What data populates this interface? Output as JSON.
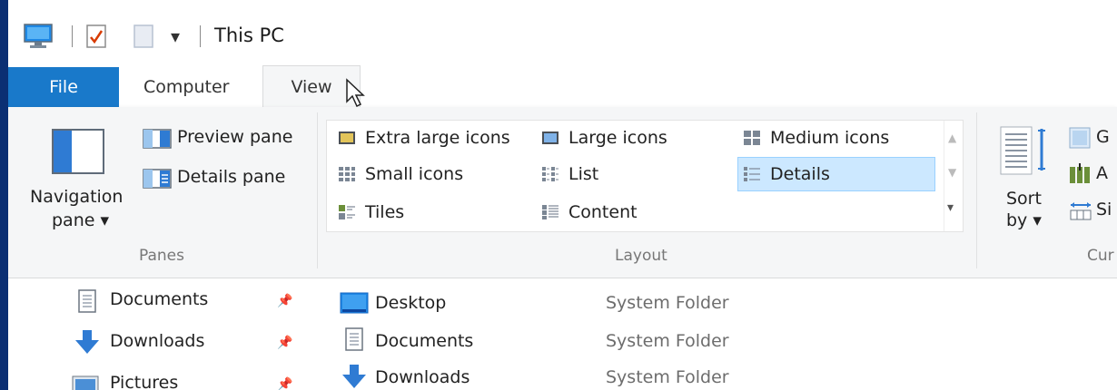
{
  "window": {
    "title": "This PC",
    "qat_dropdown_glyph": "▾"
  },
  "tabs": {
    "file": "File",
    "computer": "Computer",
    "view": "View"
  },
  "ribbon": {
    "panes": {
      "navigation_pane_line1": "Navigation",
      "navigation_pane_line2": "pane ▾",
      "preview_pane": "Preview pane",
      "details_pane": "Details pane",
      "group_label": "Panes"
    },
    "layout": {
      "items": {
        "extra_large_icons": "Extra large icons",
        "large_icons": "Large icons",
        "medium_icons": "Medium icons",
        "small_icons": "Small icons",
        "list": "List",
        "details": "Details",
        "tiles": "Tiles",
        "content": "Content"
      },
      "selected": "Details",
      "group_label": "Layout"
    },
    "current_view": {
      "sort_by_line1": "Sort",
      "sort_by_line2": "by ▾",
      "group_by_partial": "G",
      "add_columns_partial": "A",
      "size_columns_partial": "Si",
      "group_label_partial": "Cur"
    }
  },
  "navigation": {
    "items": [
      {
        "label": "Documents",
        "icon": "document-icon",
        "pinned": true
      },
      {
        "label": "Downloads",
        "icon": "download-arrow-icon",
        "pinned": true
      },
      {
        "label": "Pictures",
        "icon": "pictures-icon",
        "pinned": true
      }
    ]
  },
  "file_list": {
    "rows": [
      {
        "name": "Desktop",
        "type": "System Folder",
        "icon": "desktop-folder-icon"
      },
      {
        "name": "Documents",
        "type": "System Folder",
        "icon": "document-icon"
      },
      {
        "name": "Downloads",
        "type": "System Folder",
        "icon": "download-arrow-icon"
      }
    ]
  },
  "colors": {
    "file_tab": "#1979ca",
    "ribbon_bg": "#f5f6f7",
    "selection_bg": "#cce8ff",
    "selection_border": "#99d1ff",
    "window_border": "#0b2f73"
  }
}
